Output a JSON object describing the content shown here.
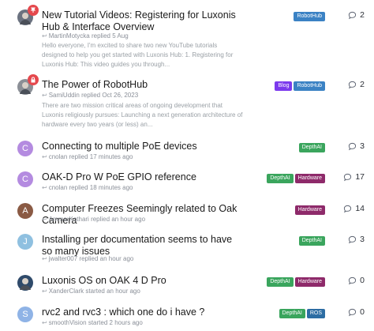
{
  "threads": [
    {
      "title": "New Tutorial Videos: Registering for Luxonis Hub & Interface Overview",
      "author": "MartinMotycka",
      "action": "replied",
      "time": "5 Aug",
      "excerpt": "Hello everyone, I'm excited to share two new YouTube tutorials designed to help you get started with Luxonis Hub: 1. Registering for Luxonis Hub: This video guides you through...",
      "avatar_letter": "",
      "avatar_color": "#6b7280",
      "badge": "pin",
      "tags": [
        {
          "label": "RobotHub",
          "color": "#3b82c4"
        }
      ],
      "replies": "2"
    },
    {
      "title": "The Power of RobotHub",
      "author": "SamiUddin",
      "action": "replied",
      "time": "Oct 26, 2023",
      "excerpt": "There are two mission critical areas of ongoing development that Luxonis religiously pursues: Launching a next generation architecture of hardware every two years (or less) an...",
      "avatar_letter": "",
      "avatar_color": "#8b8f96",
      "badge": "lock",
      "tags": [
        {
          "label": "Blog",
          "color": "#7c3aed"
        },
        {
          "label": "RobotHub",
          "color": "#3b82c4"
        }
      ],
      "replies": "2"
    },
    {
      "title": "Connecting to multiple PoE devices",
      "author": "cnolan",
      "action": "replied",
      "time": "17 minutes ago",
      "avatar_letter": "C",
      "avatar_color": "#b48be0",
      "tags": [
        {
          "label": "DepthAI",
          "color": "#3aa55d"
        }
      ],
      "replies": "3"
    },
    {
      "title": "OAK-D Pro W PoE GPIO reference",
      "author": "cnolan",
      "action": "replied",
      "time": "18 minutes ago",
      "avatar_letter": "C",
      "avatar_color": "#b48be0",
      "tags": [
        {
          "label": "DepthAI",
          "color": "#3aa55d"
        },
        {
          "label": "Hardware",
          "color": "#8e2a6a"
        }
      ],
      "replies": "17"
    },
    {
      "title": "Computer Freezes Seemingly related to Oak Camera",
      "author": "AmmarKothari",
      "action": "replied",
      "time": "an hour ago",
      "avatar_letter": "A",
      "avatar_color": "#8a5a44",
      "tags": [
        {
          "label": "Hardware",
          "color": "#8e2a6a"
        }
      ],
      "replies": "14"
    },
    {
      "title": "Installing per documentation seems to have so many issues",
      "author": "jwalter007",
      "action": "replied",
      "time": "an hour ago",
      "avatar_letter": "J",
      "avatar_color": "#8fc0e0",
      "tags": [
        {
          "label": "DepthAI",
          "color": "#3aa55d"
        }
      ],
      "replies": "3"
    },
    {
      "title": "Luxonis OS on OAK 4 D Pro",
      "author": "XanderClark",
      "action": "started",
      "time": "an hour ago",
      "avatar_letter": "",
      "avatar_color": "#2f4a6a",
      "tags": [
        {
          "label": "DepthAI",
          "color": "#3aa55d"
        },
        {
          "label": "Hardware",
          "color": "#8e2a6a"
        }
      ],
      "replies": "0"
    },
    {
      "title": "rvc2 and rvc3 : which one do i have ?",
      "author": "smoothVision",
      "action": "started",
      "time": "2 hours ago",
      "avatar_letter": "S",
      "avatar_color": "#8fb3e6",
      "tags": [
        {
          "label": "DepthAI",
          "color": "#3aa55d"
        },
        {
          "label": "ROS",
          "color": "#2d6da3"
        }
      ],
      "replies": "0"
    }
  ]
}
